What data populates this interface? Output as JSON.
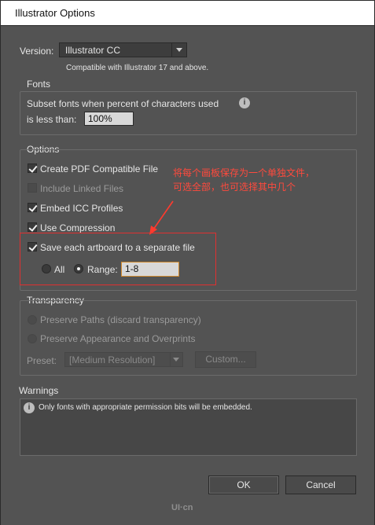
{
  "window": {
    "title": "Illustrator Options"
  },
  "version": {
    "label": "Version:",
    "selected": "Illustrator CC",
    "note": "Compatible with Illustrator 17 and above."
  },
  "fonts": {
    "legend": "Fonts",
    "subset_line1": "Subset fonts when percent of characters used",
    "subset_line2": "is less than:",
    "percent_value": "100%"
  },
  "options": {
    "legend": "Options",
    "create_pdf": "Create PDF Compatible File",
    "include_linked": "Include Linked Files",
    "embed_icc": "Embed ICC Profiles",
    "use_compression": "Use Compression",
    "save_artboards": "Save each artboard to a separate file",
    "all_label": "All",
    "range_label": "Range:",
    "range_value": "1-8"
  },
  "annotation": {
    "line1": "将每个画板保存为一个单独文件，",
    "line2": "可选全部，也可选择其中几个"
  },
  "transparency": {
    "legend": "Transparency",
    "preserve_paths": "Preserve Paths (discard transparency)",
    "preserve_appearance": "Preserve Appearance and Overprints",
    "preset_label": "Preset:",
    "preset_value": "[Medium Resolution]",
    "custom_button": "Custom..."
  },
  "warnings": {
    "legend": "Warnings",
    "message": "Only fonts with appropriate permission bits will be embedded."
  },
  "buttons": {
    "ok": "OK",
    "cancel": "Cancel"
  },
  "watermark": "UI·cn",
  "colors": {
    "annotation": "#ff4a3d",
    "highlight_border": "#e03030"
  },
  "icons": {
    "info": "info-icon",
    "arrow": "red-arrow-icon"
  }
}
